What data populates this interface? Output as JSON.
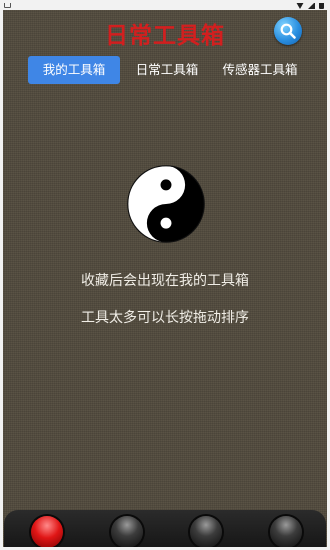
{
  "app": {
    "title": "日常工具箱"
  },
  "search": {
    "icon": "search-icon"
  },
  "tabs": [
    {
      "label": "我的工具箱",
      "active": true
    },
    {
      "label": "日常工具箱",
      "active": false
    },
    {
      "label": "传感器工具箱",
      "active": false
    }
  ],
  "empty_state": {
    "icon": "yin-yang-icon",
    "line1": "收藏后会出现在我的工具箱",
    "line2": "工具太多可以长按拖动排序"
  },
  "dock": {
    "buttons": [
      {
        "icon": "dock-button-icon",
        "color": "#e01616",
        "active": true
      },
      {
        "icon": "dock-button-icon",
        "color": "#3c3c3c",
        "active": false
      },
      {
        "icon": "dock-button-icon",
        "color": "#3c3c3c",
        "active": false
      },
      {
        "icon": "dock-button-icon",
        "color": "#3c3c3c",
        "active": false
      }
    ]
  },
  "colors": {
    "title": "#d21f1f",
    "tab_active": "#3f86e6",
    "background": "#5a5345"
  }
}
